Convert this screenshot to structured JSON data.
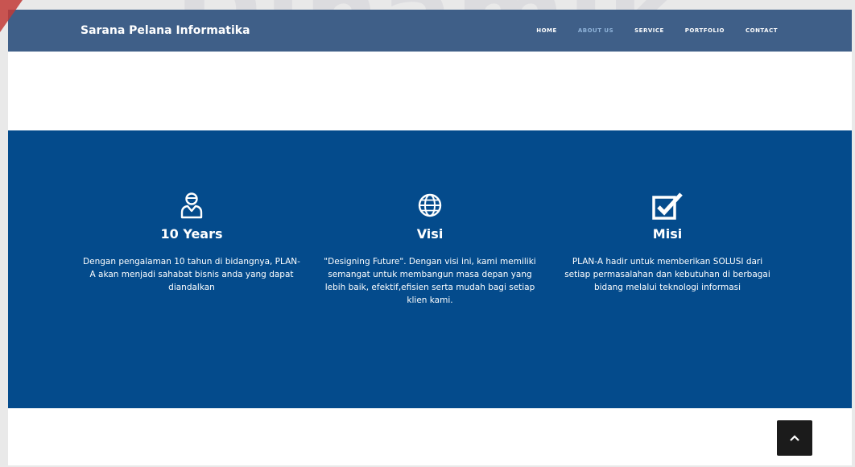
{
  "watermark": "Dinamik",
  "header": {
    "brand": "Sarana Pelana Informatika",
    "nav": [
      {
        "label": "HOME",
        "active": false
      },
      {
        "label": "ABOUT US",
        "active": true
      },
      {
        "label": "SERVICE",
        "active": false
      },
      {
        "label": "PORTFOLIO",
        "active": false
      },
      {
        "label": "CONTACT",
        "active": false
      }
    ]
  },
  "features": [
    {
      "icon": "user-icon",
      "title": "10 Years",
      "description": "Dengan pengalaman 10 tahun di bidangnya, PLAN-A akan menjadi sahabat bisnis anda yang dapat diandalkan"
    },
    {
      "icon": "globe-icon",
      "title": "Visi",
      "description": "\"Designing Future\". Dengan visi ini, kami memiliki semangat untuk membangun masa depan yang lebih baik, efektif,efisien serta mudah bagi setiap klien kami."
    },
    {
      "icon": "check-square-icon",
      "title": "Misi",
      "description": "PLAN-A hadir untuk memberikan SOLUSI dari setiap permasalahan dan kebutuhan di berbagai bidang melalui teknologi informasi"
    }
  ],
  "colors": {
    "navbar": "#3f5f88",
    "band": "#044b8c",
    "nav_active": "#8fb3d9",
    "scroll_button": "#1b1b1b"
  },
  "scroll_top_icon": "chevron-up-icon"
}
